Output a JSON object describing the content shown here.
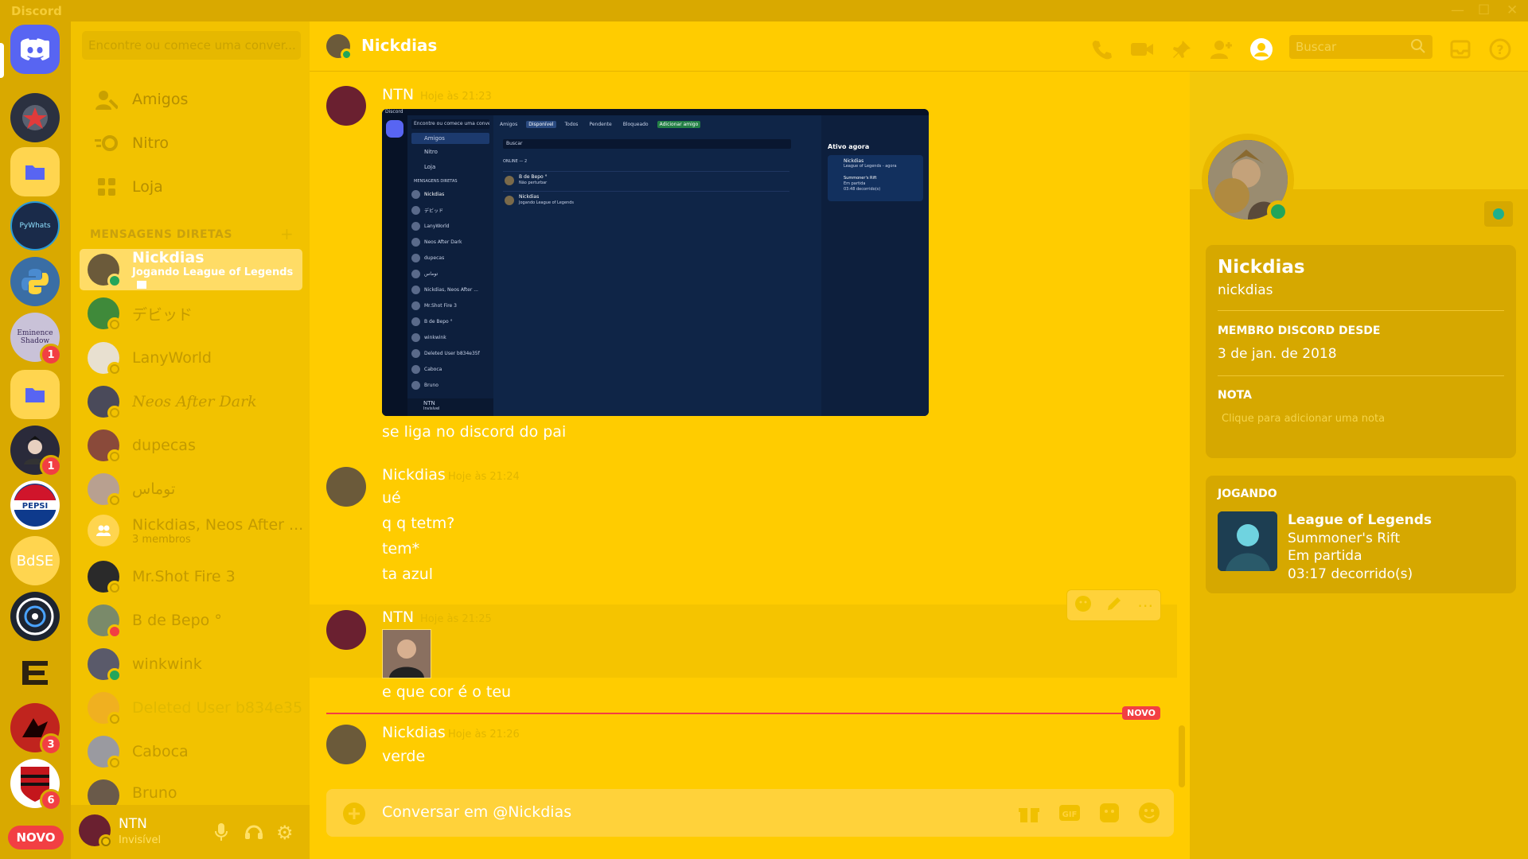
{
  "app": {
    "title": "Discord"
  },
  "window_controls": [
    "—",
    "☐",
    "✕"
  ],
  "guilds": [
    {
      "name": "Direct Messages",
      "icon": "discord-logo-icon",
      "color": "#5865f2"
    },
    {
      "name": "server-star",
      "icon": "star-badge-icon",
      "color": "#2b3140"
    },
    {
      "name": "folder",
      "icon": "folder-icon",
      "color": "#5865f2"
    },
    {
      "name": "AsyncPyWhats",
      "icon": "asyncpywhats-icon",
      "color": "#1a2b4a"
    },
    {
      "name": "python",
      "icon": "python-icon",
      "color": "#3a6ea5"
    },
    {
      "name": "Eminence in Shadow",
      "icon": "eminence-shadow-icon",
      "color": "#c9c2d8",
      "badge": "1"
    },
    {
      "name": "folder2",
      "icon": "folder-icon",
      "color": "#5865f2"
    },
    {
      "name": "anime",
      "icon": "anime-avatar-icon",
      "color": "#2a2a3a",
      "badge": "1"
    },
    {
      "name": "pepsi",
      "icon": "pepsi-icon",
      "color": "#0e3a8c"
    },
    {
      "name": "BdSE",
      "icon": "bdse-text-icon",
      "color": "#ffd54f",
      "text": "BdSE"
    },
    {
      "name": "circle",
      "icon": "target-icon",
      "color": "#1d2430"
    },
    {
      "name": "gold-logo",
      "icon": "gold-emblem-icon",
      "color": "#d9a900"
    },
    {
      "name": "dragon",
      "icon": "red-dragon-icon",
      "color": "#c0241e",
      "badge": "3"
    },
    {
      "name": "flamengo",
      "icon": "flamengo-icon",
      "color": "#ffffff",
      "badge": "6"
    }
  ],
  "new_pill": "NOVO",
  "dm_search_placeholder": "Encontre ou comece uma conver...",
  "nav": [
    {
      "label": "Amigos",
      "icon": "friends-icon"
    },
    {
      "label": "Nitro",
      "icon": "nitro-icon"
    },
    {
      "label": "Loja",
      "icon": "shop-icon"
    }
  ],
  "dm_section": {
    "title": "MENSAGENS DIRETAS",
    "add": "+"
  },
  "dms": [
    {
      "name": "Nickdias",
      "sub": "Jogando League of Legends",
      "active": true,
      "status": "online"
    },
    {
      "name": "デビッド",
      "status": "offline"
    },
    {
      "name": "LanyWorld",
      "status": "offline"
    },
    {
      "name": "Neos After Dark",
      "italic": true,
      "status": "offline"
    },
    {
      "name": "dupecas",
      "status": "offline"
    },
    {
      "name": "توماس",
      "status": "offline"
    },
    {
      "name": "Nickdias, Neos After ...",
      "sub": "3 membros",
      "group": true
    },
    {
      "name": "Mr.Shot Fire 3",
      "status": "offline"
    },
    {
      "name": "B de Bepo °",
      "status": "dnd"
    },
    {
      "name": "winkwink",
      "status": "online"
    },
    {
      "name": "Deleted User b834e35f",
      "status": "offline"
    },
    {
      "name": "Caboca",
      "status": "offline"
    },
    {
      "name": "Bruno",
      "status": "offline"
    }
  ],
  "user": {
    "name": "NTN",
    "status": "Invisível"
  },
  "channel": {
    "name": "Nickdias"
  },
  "header_search_placeholder": "Buscar",
  "messages": [
    {
      "author": "NTN",
      "time": "Hoje às 21:23",
      "lines": [
        "se liga no discord do pai"
      ],
      "has_screenshot": true
    },
    {
      "author": "Nickdias",
      "time": "Hoje às 21:24",
      "lines": [
        "ué",
        "q q tetm?",
        "tem*",
        "ta azul"
      ]
    },
    {
      "author": "NTN",
      "time": "Hoje às 21:25",
      "lines": [
        "e que cor é o teu"
      ],
      "has_image": true
    },
    {
      "author": "Nickdias",
      "time": "Hoje às 21:26",
      "lines": [
        "verde"
      ]
    }
  ],
  "new_divider": "NOVO",
  "composer_placeholder": "Conversar em @Nickdias",
  "embedded_screenshot": {
    "app": "Discord",
    "search": "Encontre ou comece uma conve...",
    "tabs": [
      "Amigos",
      "Disponível",
      "Todos",
      "Pendente",
      "Bloqueado",
      "Adicionar amigo"
    ],
    "search_friends": "Buscar",
    "online_label": "ONLINE — 2",
    "friends": [
      {
        "name": "B de Bepo °",
        "status": "Não perturbar"
      },
      {
        "name": "Nickdias",
        "status": "Jogando League of Legends"
      }
    ],
    "active_now": "Ativo agora",
    "active_card": {
      "name": "Nickdias",
      "game": "League of Legends - agora",
      "map": "Summoner's Rift",
      "state": "Em partida",
      "elapsed": "03:48 decorrido(s)"
    },
    "side_nav": [
      "Amigos",
      "Nitro",
      "Loja"
    ],
    "dm_header": "MENSAGENS DIRETAS",
    "dm_list": [
      "Nickdias",
      "デビッド",
      "LanyWorld",
      "Neos After Dark",
      "dupecas",
      "توماس",
      "Nickdias, Neos After ...",
      "Mr.Shot Fire 3",
      "B de Bepo °",
      "winkwink",
      "Deleted User b834e35f",
      "Caboca",
      "Bruno"
    ],
    "dm_active_sub": "Jogando League of Legends",
    "group_sub": "3 membros",
    "user": {
      "name": "NTN",
      "status": "Invisível"
    }
  },
  "profile": {
    "display_name": "Nickdias",
    "username": "nickdias",
    "member_since_label": "MEMBRO DISCORD DESDE",
    "member_since": "3 de jan. de 2018",
    "note_label": "NOTA",
    "note_placeholder": "Clique para adicionar uma nota",
    "playing_label": "JOGANDO",
    "game": "League of Legends",
    "map": "Summoner's Rift",
    "state": "Em partida",
    "elapsed": "03:17 decorrido(s)"
  }
}
